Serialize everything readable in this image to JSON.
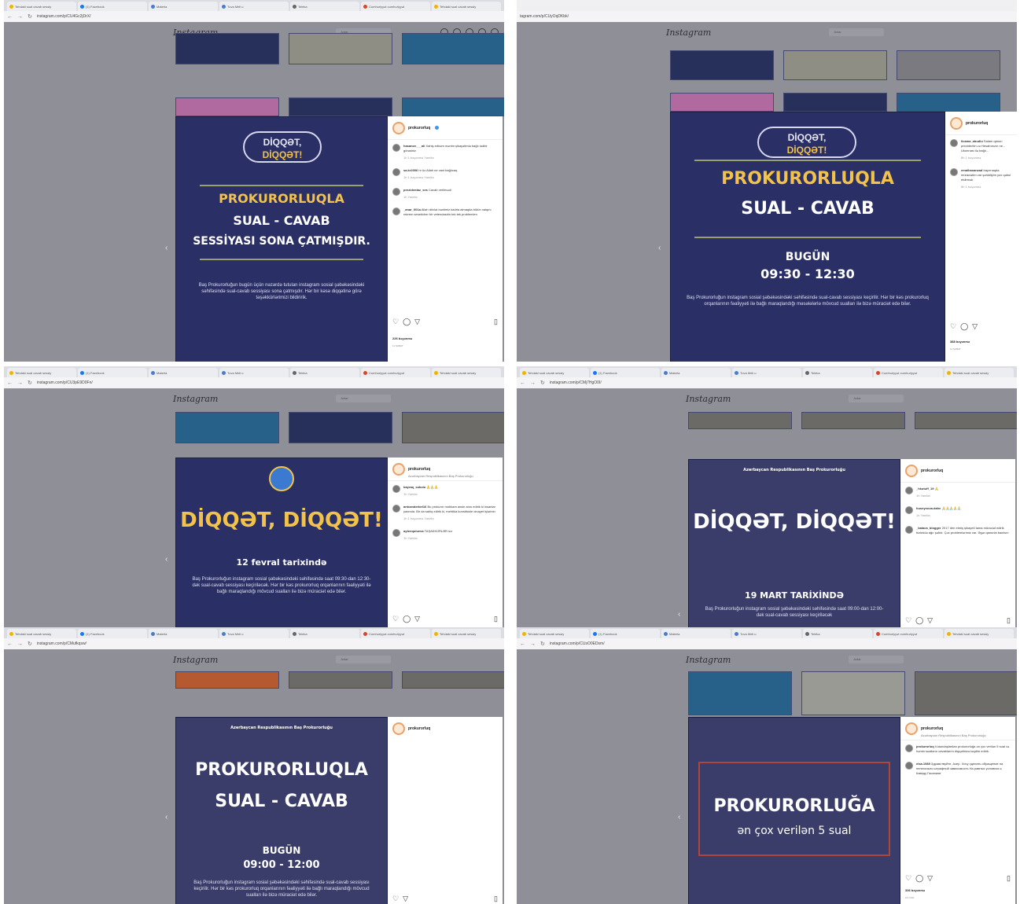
{
  "browser": {
    "tabs": [
      "Tehdaki sual cavab sessiy",
      "(1) Facebook",
      "Materia",
      "Tuva Meli u",
      "Teleka",
      "Cumhuriyyət cumhuriyyət",
      "Tehdaki sual cavab sessiy"
    ],
    "urls": [
      "instagram.com/p/CU4Gc2jDrX/",
      "tagram.com/p/CUyOqDKbk/",
      "instagram.com/p/CU3pE9D0Fn/",
      "instagram.com/p/CMj7HgO0I/",
      "instagram.com/p/CMufkqsw/",
      "instagram.com/p/CUsO0EDsm/"
    ]
  },
  "instagram": {
    "logo": "Instagram",
    "search": "Axtar"
  },
  "posts": [
    {
      "pill_line1": "DİQQƏT,",
      "pill_line2": "DİQQƏT!",
      "title_line1": "PROKURORLUQLA",
      "title_line2": "SUAL - CAVAB",
      "title_line3": "SESSİYASI SONA ÇATMIŞDIR.",
      "body": "Baş Prokurorluğun bugün üçün nəzərdə tutulan instagram sosial şəbəkəsindəki səhifəsində sual-cavab sessiyası sona çatmışdır. Hər bir kəsə diqqətinə görə təşəkkürlərimizi bildiririk.",
      "username": "prokurorluq",
      "comments": [
        {
          "user": "hasanov___ali",
          "text": "Xahiş edirəm mənim şikayətimlə bağlı tədbir görəsiniz",
          "meta": "1h  1 bəyənmə  Yanıtla"
        },
        {
          "user": "sa.kr2006",
          "text": "hr üz Allah ne vaxt bağlıcaq",
          "meta": "1h  1 bəyənmə  Yanıtla"
        },
        {
          "user": "prezidentaz_ses",
          "text": "Cavab verilmədi",
          "meta": "1h  Yanıtla"
        },
        {
          "user": "_anar_001a",
          "text": "Allah dövlət bəxtimiz kadrla almaqda bütün xalqını rekrem seseticher bir vetendasirin tek tek problemlen",
          "meta": ""
        }
      ],
      "likes": "226 bəyənmə",
      "date": "11 ŞUBAT"
    },
    {
      "pill_line1": "DİQQƏT,",
      "pill_line2": "DİQQƏT!",
      "title_line1": "PROKURORLUQLA",
      "title_line2": "SUAL - CAVAB",
      "time_line1": "BUGÜN",
      "time_line2": "09:30 - 12:30",
      "body": "Baş Prokurorluğun instagram sosial şəbəkəsindəki səhifəsində sual-cavab sessiyası keçirilir. Hər bir kəs prokurorluq orqanlarının fəaliyyəti ilə bağlı maraqlandığı məsələlərlə mövcud sualları ilə bizə müraciət edə bilər.",
      "username": "prokurorluq",
      "comments": [
        {
          "user": "ilcama_abudlu",
          "text": "Salam qanun prezidentin və Hesabınızın ne... Ukonnası ilə bağlı...",
          "meta": "8h  1 bəyənmə"
        },
        {
          "user": "emalhasanzad",
          "text": "bayırnaqda müraciətim var şəhidliyim yox qəbul etdirmək",
          "meta": "8h  1 bəyənmə"
        }
      ],
      "likes": "388 bəyənmə",
      "date": "11 ŞUBAT"
    },
    {
      "headline": "DİQQƏT, DİQQƏT!",
      "date_line": "12 fevral tarixində",
      "body": "Baş Prokurorluğun instagram sosial şəbəkəsindəki səhifəsində saat 09:30-dan 12:30-dək sual-cavab sessiyası keçiriləcək. Hər bir kəs prokurorluq orqanlarının fəaliyyəti ilə bağlı maraqlandığı mövcud sualları ilə bizə müraciət edə bilər.",
      "username": "prokurorluq",
      "subtitle": "Azərbaycan Respublikasının Baş Prokurorluğu",
      "comments": [
        {
          "user": "bayraq_sokolu",
          "text": "🙏🙏🙏",
          "meta": "1h  Yanıtla"
        },
        {
          "user": "antcanderbel16",
          "text": "Bu prokuror mohkam axsin arzu edirik ki insanlar yaxında. Bir da sahiq edirik ki, mehtika konstitusie cinayet işlərinin",
          "meta": "1h  1 bəyənmə  Yanıtla"
        },
        {
          "user": "aytenqulueva",
          "text": "TAŞAKKÜRLƏR sız",
          "meta": "1h  Yanıtla"
        }
      ]
    },
    {
      "header_org": "Azərbaycan Respublikasının Baş Prokurorluğu",
      "headline": "DİQQƏT, DİQQƏT!",
      "date_line": "19 MART TARİXİNDƏ",
      "body": "Baş Prokurorluğun instagram sosial şəbəkəsindəki səhifəsində saat 09:00-dan 12:00-dək sual-cavab sessiyası keçiriləcək",
      "username": "prokurorluq",
      "comments": [
        {
          "user": "_hkutuff_19",
          "text": "🙏",
          "meta": "1h  Yanıtla"
        },
        {
          "user": "huseynova.dahe",
          "text": "🙏🙏🙏🙏🙏",
          "meta": "1h  Yanıtla"
        },
        {
          "user": "_balaca_blogger",
          "text": "2017 den etmiş şikayeti tama müraciət edirik bizimidə ağır şəhid. Çox problemlərimiz var. Əgər qanunla baxılsın",
          "meta": ""
        }
      ]
    },
    {
      "header_org": "Azərbaycan Respublikasının Baş Prokurorluğu",
      "title_line1": "PROKURORLUQLA",
      "title_line2": "SUAL - CAVAB",
      "time_line1": "BUGÜN",
      "time_line2": "09:00 - 12:00",
      "body": "Baş Prokurorluğun instagram sosial şəbəkəsindəki səhifəsində sual-cavab sessiyası keçirilir. Hər bir kəs prokurorluq orqanlarının fəaliyyəti ilə bağlı maraqlandığı mövcud sualları ilə bizə müraciət edə bilər.",
      "username": "prokurorluq"
    },
    {
      "title_line1": "PROKURORLUĞA",
      "title_line2": "ən çox verilən 5 sual",
      "username": "prokurorluq",
      "subtitle": "Azərbaycan Respublikasının Baş Prokurorluğu",
      "comments": [
        {
          "user": "prokurorluq",
          "text": "Vətəndaşlardan prokurorluğa ən çox verilən 5 sual və həmin sualların cavablarını diqqətinizə təqdim edirik.",
          "meta": ""
        },
        {
          "user": "elsa.1989",
          "text": "Здравствуйте, Азер. Хочу сделать обращение на нелегально штрафной зависимость На равных условиях к Каведу Гасаниов",
          "meta": ""
        }
      ],
      "likes": "336 bəyənmə",
      "date": "15 İYUN"
    }
  ]
}
